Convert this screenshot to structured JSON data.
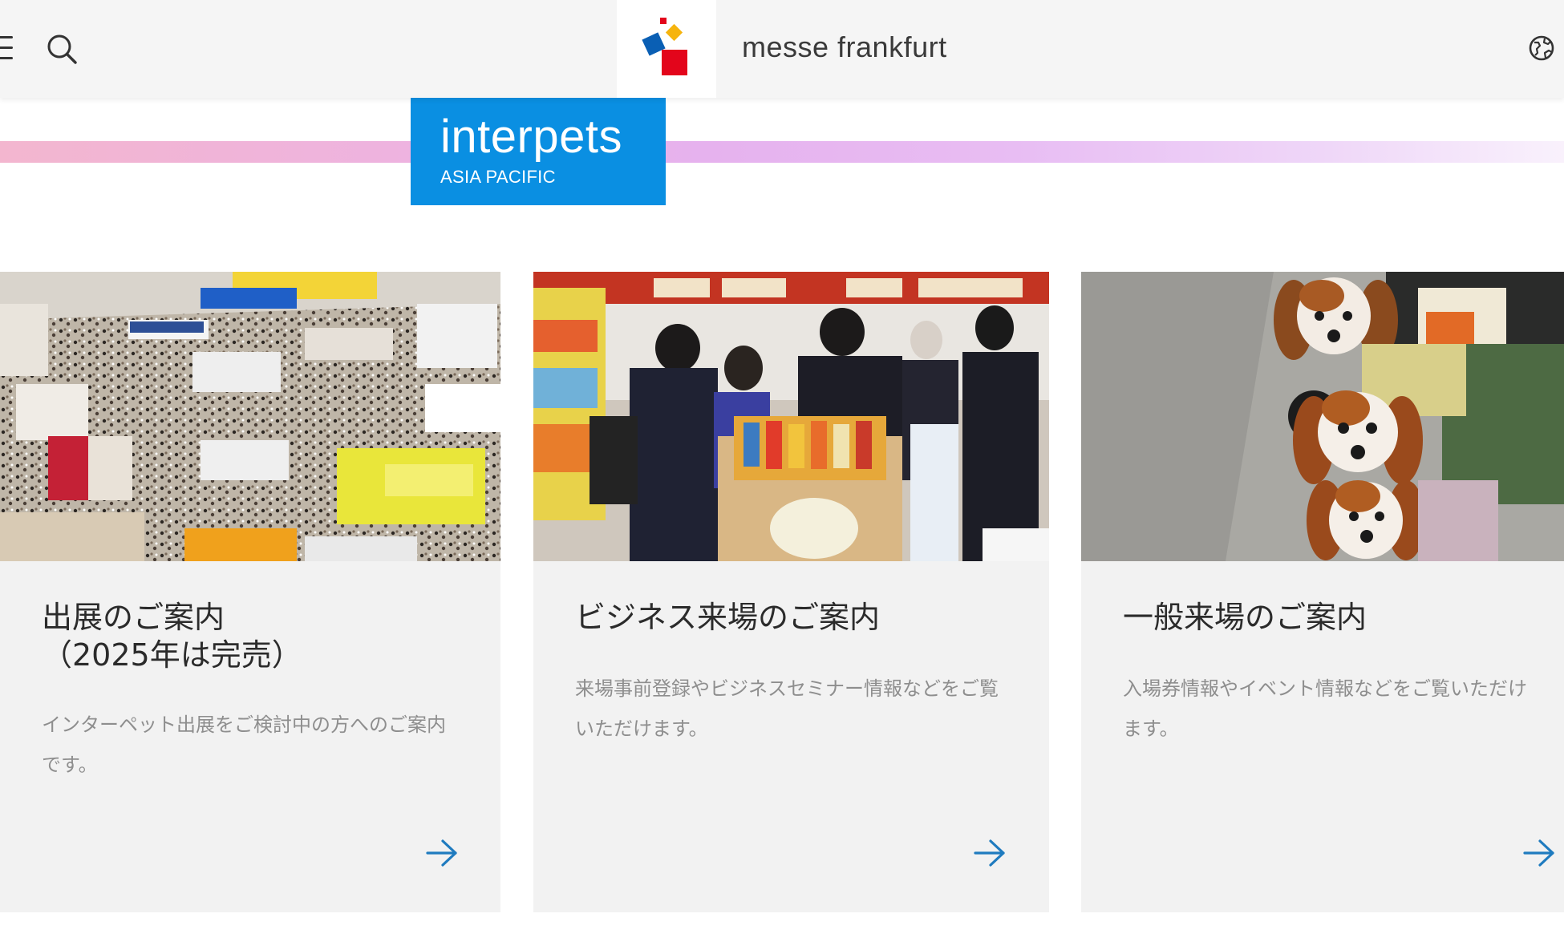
{
  "header": {
    "brand": "messe frankfurt",
    "icons": {
      "menu": "hamburger-menu-icon",
      "search": "search-icon",
      "logo": "messe-frankfurt-logo",
      "language": "globe-icon"
    }
  },
  "event": {
    "name": "interpets",
    "subtitle": "ASIA PACIFIC"
  },
  "cards": [
    {
      "image": "exhibition-hall-photo",
      "title": "出展のご案内\n（2025年は完売）",
      "description": "インターペット出展をご検討中の方へのご案内です。",
      "arrow": "arrow-right-icon"
    },
    {
      "image": "business-visitors-photo",
      "title": "ビジネス来場のご案内",
      "description": "来場事前登録やビジネスセミナー情報などをご覧いただけます。",
      "arrow": "arrow-right-icon"
    },
    {
      "image": "dogs-photo",
      "title": "一般来場のご案内",
      "description": "入場券情報やイベント情報などをご覧いただけます。",
      "arrow": "arrow-right-icon"
    }
  ],
  "colors": {
    "header_bg": "#f5f5f5",
    "event_logo_bg": "#0a8fe2",
    "card_bg": "#f2f2f2",
    "arrow": "#1f7bbf",
    "logo_red": "#e3051b",
    "logo_blue": "#0a5fb4",
    "logo_yellow": "#f6b40e"
  }
}
